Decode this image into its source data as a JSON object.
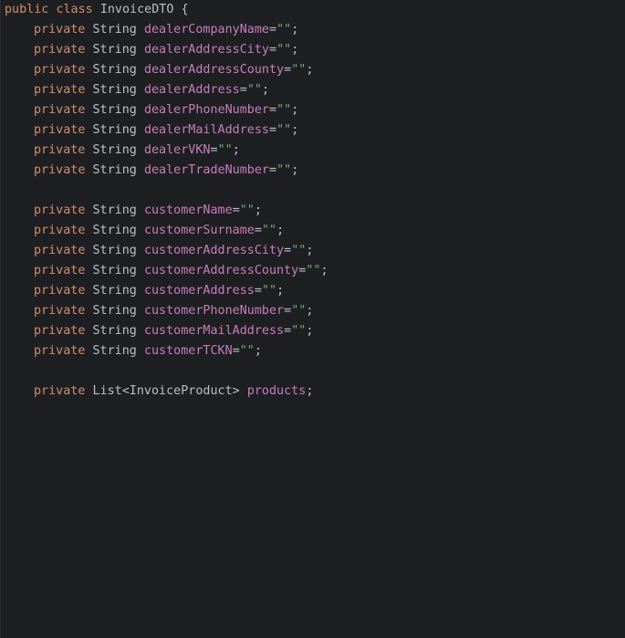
{
  "editor": {
    "class_decl": {
      "kw_public": "public",
      "kw_class": "class",
      "name": "InvoiceDTO",
      "open_brace": "{"
    },
    "dealer_fields": [
      {
        "modifier": "private",
        "type": "String",
        "name": "dealerCompanyName",
        "init": "\"\""
      },
      {
        "modifier": "private",
        "type": "String",
        "name": "dealerAddressCity",
        "init": "\"\""
      },
      {
        "modifier": "private",
        "type": "String",
        "name": "dealerAddressCounty",
        "init": "\"\""
      },
      {
        "modifier": "private",
        "type": "String",
        "name": "dealerAddress",
        "init": "\"\""
      },
      {
        "modifier": "private",
        "type": "String",
        "name": "dealerPhoneNumber",
        "init": "\"\""
      },
      {
        "modifier": "private",
        "type": "String",
        "name": "dealerMailAddress",
        "init": "\"\""
      },
      {
        "modifier": "private",
        "type": "String",
        "name": "dealerVKN",
        "init": "\"\""
      },
      {
        "modifier": "private",
        "type": "String",
        "name": "dealerTradeNumber",
        "init": "\"\""
      }
    ],
    "customer_fields": [
      {
        "modifier": "private",
        "type": "String",
        "name": "customerName",
        "init": "\"\""
      },
      {
        "modifier": "private",
        "type": "String",
        "name": "customerSurname",
        "init": "\"\""
      },
      {
        "modifier": "private",
        "type": "String",
        "name": "customerAddressCity",
        "init": "\"\""
      },
      {
        "modifier": "private",
        "type": "String",
        "name": "customerAddressCounty",
        "init": "\"\""
      },
      {
        "modifier": "private",
        "type": "String",
        "name": "customerAddress",
        "init": "\"\""
      },
      {
        "modifier": "private",
        "type": "String",
        "name": "customerPhoneNumber",
        "init": "\"\""
      },
      {
        "modifier": "private",
        "type": "String",
        "name": "customerMailAddress",
        "init": "\"\""
      },
      {
        "modifier": "private",
        "type": "String",
        "name": "customerTCKN",
        "init": "\"\""
      }
    ],
    "products_field": {
      "modifier": "private",
      "type": "List<InvoiceProduct>",
      "name": "products"
    },
    "colors": {
      "background": "#1e1f22",
      "keyword": "#cf8e6d",
      "field": "#c77dbb",
      "string": "#6aab73",
      "text": "#bcbec4"
    }
  }
}
